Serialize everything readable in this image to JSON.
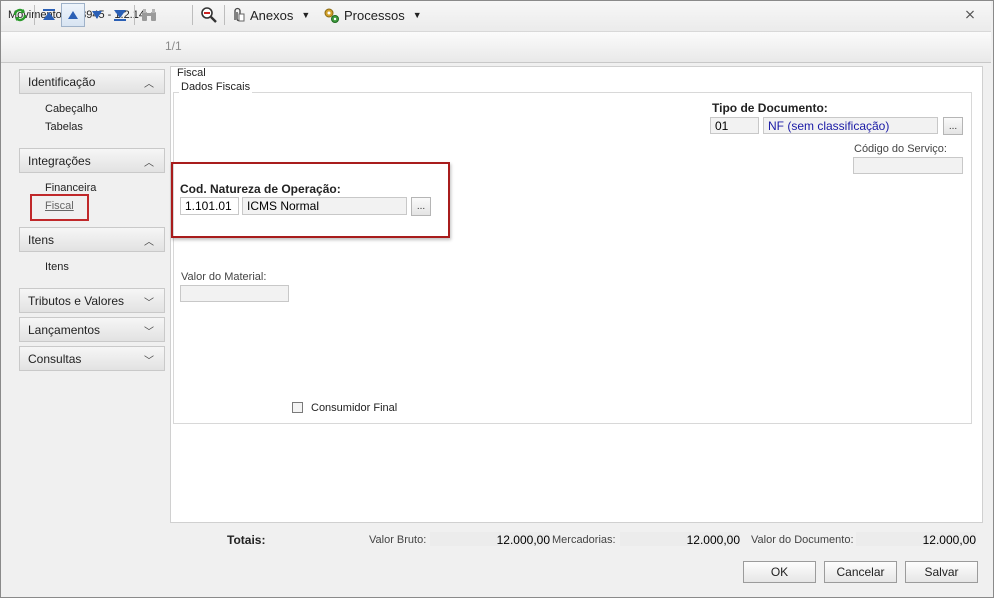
{
  "window": {
    "title": "Movimento: 078945 - 1.2.14",
    "close_glyph": "⨯"
  },
  "toolbar": {
    "record_counter": "1/1",
    "anexos_label": "Anexos",
    "processos_label": "Processos"
  },
  "sidebar": {
    "groups": [
      {
        "label": "Identificação",
        "items": [
          "Cabeçalho",
          "Tabelas"
        ]
      },
      {
        "label": "Integrações",
        "items": [
          "Financeira",
          "Fiscal"
        ]
      },
      {
        "label": "Itens",
        "items": [
          "Itens"
        ]
      },
      {
        "label": "Tributos e Valores"
      },
      {
        "label": "Lançamentos"
      },
      {
        "label": "Consultas"
      }
    ],
    "selected_item": "Fiscal"
  },
  "main": {
    "section_title": "Fiscal",
    "group_title": "Dados Fiscais",
    "tipo_documento": {
      "label": "Tipo de Documento:",
      "code": "01",
      "description": "NF (sem classificação)"
    },
    "codigo_servico": {
      "label": "Código do Serviço:",
      "value": ""
    },
    "natureza": {
      "label": "Cod. Natureza de Operação:",
      "code": "1.101.01",
      "description": "ICMS Normal"
    },
    "valor_material": {
      "label": "Valor do Material:",
      "value": ""
    },
    "consumidor_final": {
      "label": "Consumidor Final",
      "checked": false
    },
    "ellipsis": "..."
  },
  "totals": {
    "label": "Totais:",
    "valor_bruto_label": "Valor Bruto:",
    "valor_bruto": "12.000,00",
    "mercadorias_label": "Mercadorias:",
    "mercadorias": "12.000,00",
    "valor_documento_label": "Valor do Documento:",
    "valor_documento": "12.000,00"
  },
  "buttons": {
    "ok": "OK",
    "cancel": "Cancelar",
    "save": "Salvar"
  },
  "colors": {
    "highlight_border": "#a81c1c",
    "link_blue": "#1a1aa6"
  }
}
